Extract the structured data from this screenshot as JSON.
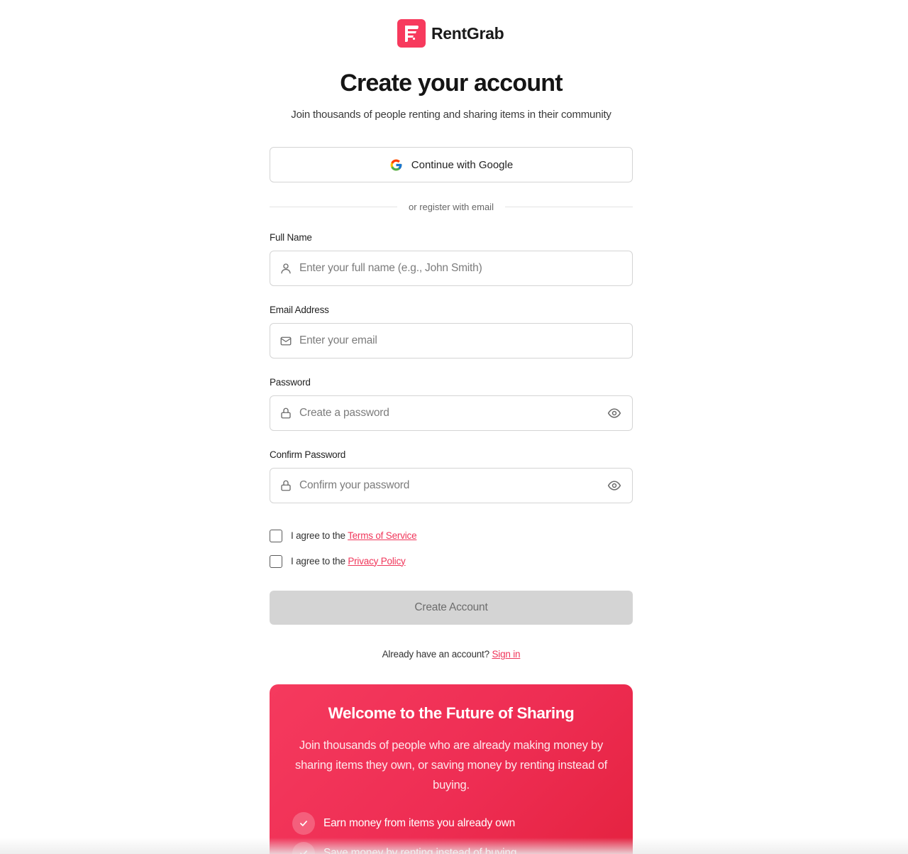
{
  "brand": {
    "name": "RentGrab",
    "color": "#f73a5d"
  },
  "header": {
    "title": "Create your account",
    "subtitle": "Join thousands of people renting and sharing items in their community"
  },
  "social": {
    "google_label": "Continue with Google",
    "icon": "google-icon"
  },
  "divider_text": "or register with email",
  "form": {
    "full_name": {
      "label": "Full Name",
      "placeholder": "Enter your full name (e.g., John Smith)",
      "value": "",
      "icon": "user-icon"
    },
    "email": {
      "label": "Email Address",
      "placeholder": "Enter your email",
      "value": "",
      "icon": "mail-icon"
    },
    "password": {
      "label": "Password",
      "placeholder": "Create a password",
      "value": "",
      "icon": "lock-icon",
      "toggle_icon": "eye-icon"
    },
    "confirm_password": {
      "label": "Confirm Password",
      "placeholder": "Confirm your password",
      "value": "",
      "icon": "lock-icon",
      "toggle_icon": "eye-icon"
    }
  },
  "agreements": {
    "terms": {
      "prefix": "I agree to the",
      "link": "Terms of Service",
      "checked": false
    },
    "privacy": {
      "prefix": "I agree to the",
      "link": "Privacy Policy",
      "checked": false
    }
  },
  "submit_label": "Create Account",
  "signin": {
    "prompt": "Already have an account?",
    "link": "Sign in"
  },
  "promo": {
    "title": "Welcome to the Future of Sharing",
    "text": "Join thousands of people who are already making money by sharing items they own, or saving money by renting instead of buying.",
    "benefits": [
      "Earn money from items you already own",
      "Save money by renting instead of buying"
    ]
  },
  "colors": {
    "accent": "#f0365a",
    "disabled_button": "#d4d4d4",
    "border": "#d4d4d4"
  }
}
